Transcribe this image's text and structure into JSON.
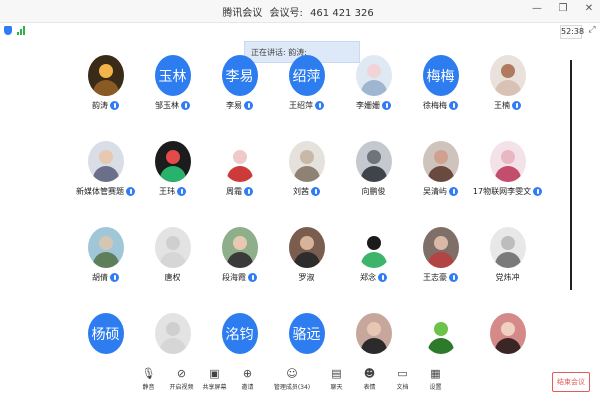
{
  "window": {
    "app_name": "腾讯会议",
    "meeting_id_label": "会议号:",
    "meeting_id": "461 421 326"
  },
  "timer": "52:38",
  "speaking": "正在讲话: 韵涛;",
  "colors": {
    "accent": "#2d7cf0",
    "mic": "#2f7cf6",
    "end": "#e35a5a"
  },
  "participants": [
    [
      {
        "name": "韵涛",
        "avatar": "photo-warm",
        "mic": true
      },
      {
        "name": "邹玉林",
        "avatar_text": "玉林",
        "mic": true
      },
      {
        "name": "李易",
        "avatar_text": "李易",
        "mic": true
      },
      {
        "name": "王绍萍",
        "avatar_text": "绍萍",
        "mic": true
      },
      {
        "name": "李姗姗",
        "avatar": "photo-cartoon",
        "mic": true
      },
      {
        "name": "徐梅梅",
        "avatar_text": "梅梅",
        "mic": true
      },
      {
        "name": "王楠",
        "avatar": "photo-child",
        "mic": true
      }
    ],
    [
      {
        "name": "新媒体管赛题",
        "avatar": "photo-person",
        "mic": true
      },
      {
        "name": "王玮",
        "avatar": "photo-logo",
        "mic": true
      },
      {
        "name": "周霜",
        "avatar": "photo-meme",
        "mic": true
      },
      {
        "name": "刘茜",
        "avatar": "photo-pet",
        "mic": true
      },
      {
        "name": "向鹏俊",
        "avatar": "photo-street",
        "mic": false
      },
      {
        "name": "吴清屿",
        "avatar": "photo-girl",
        "mic": true
      },
      {
        "name": "17物联网李雯文",
        "avatar": "photo-child2",
        "mic": true
      }
    ],
    [
      {
        "name": "胡倩",
        "avatar": "photo-outdoor",
        "mic": true
      },
      {
        "name": "唐权",
        "avatar": "photo-default",
        "mic": false
      },
      {
        "name": "段海霞",
        "avatar": "photo-kid",
        "mic": true
      },
      {
        "name": "罗淑",
        "avatar": "photo-man",
        "mic": false
      },
      {
        "name": "郑念",
        "avatar": "photo-panda",
        "mic": true
      },
      {
        "name": "王志豪",
        "avatar": "photo-room",
        "mic": true
      },
      {
        "name": "党炜冲",
        "avatar": "photo-sketch",
        "mic": false
      }
    ],
    [
      {
        "name": "",
        "avatar_text": "杨硕",
        "mic": false
      },
      {
        "name": "",
        "avatar": "photo-default",
        "mic": false
      },
      {
        "name": "",
        "avatar_text": "洺钧",
        "mic": false
      },
      {
        "name": "",
        "avatar_text": "骆远",
        "mic": false
      },
      {
        "name": "",
        "avatar": "photo-woman",
        "mic": false
      },
      {
        "name": "",
        "avatar": "photo-frog",
        "mic": false
      },
      {
        "name": "",
        "avatar": "photo-lady",
        "mic": false
      }
    ]
  ],
  "toolbar": [
    {
      "label": "静音",
      "icon": "mic-icon"
    },
    {
      "label": "开启视频",
      "icon": "video-off-icon"
    },
    {
      "label": "共享屏幕",
      "icon": "screen-share-icon"
    },
    {
      "label": "邀请",
      "icon": "invite-icon"
    },
    {
      "label": "管理成员(34)",
      "icon": "members-icon"
    },
    {
      "label": "聊天",
      "icon": "chat-icon"
    },
    {
      "label": "表情",
      "icon": "emoji-icon"
    },
    {
      "label": "文档",
      "icon": "document-icon"
    },
    {
      "label": "设置",
      "icon": "settings-icon"
    }
  ],
  "end_button": "结束会议"
}
